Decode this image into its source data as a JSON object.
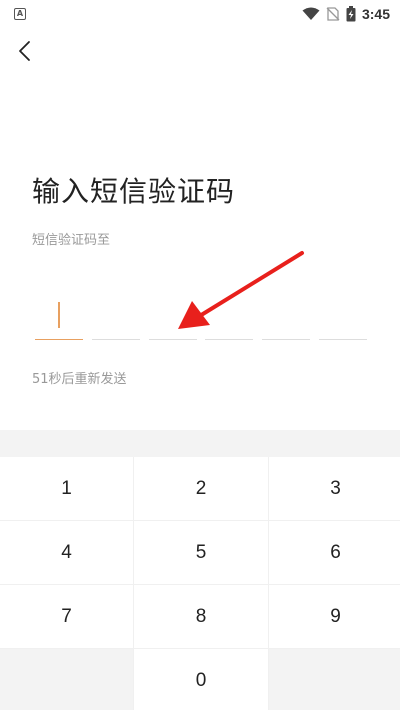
{
  "status_bar": {
    "notification_icon_label": "A",
    "time": "3:45",
    "icons": [
      "wifi-icon",
      "no-sim-icon",
      "battery-charging-icon"
    ]
  },
  "page": {
    "title": "输入短信验证码",
    "subtitle": "短信验证码至",
    "resend": "51秒后重新发送",
    "accent_color": "#e8a060"
  },
  "code_inputs": [
    "",
    "",
    "",
    "",
    "",
    ""
  ],
  "keypad": {
    "keys": [
      "1",
      "2",
      "3",
      "4",
      "5",
      "6",
      "7",
      "8",
      "9",
      "",
      "0",
      ""
    ]
  },
  "annotation_color": "#e8201c"
}
